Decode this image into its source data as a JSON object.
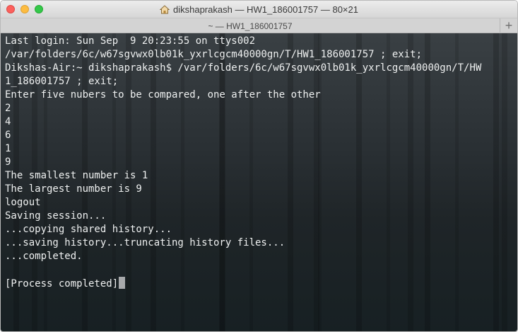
{
  "window": {
    "title": "dikshaprakash — HW1_186001757 — 80×21",
    "title_icon": "home-icon"
  },
  "tabbar": {
    "tab_label": "~ — HW1_186001757",
    "add_label": "+"
  },
  "terminal": {
    "lines": [
      "Last login: Sun Sep  9 20:23:55 on ttys002",
      "/var/folders/6c/w67sgvwx0lb01k_yxrlcgcm40000gn/T/HW1_186001757 ; exit;",
      "Dikshas-Air:~ dikshaprakash$ /var/folders/6c/w67sgvwx0lb01k_yxrlcgcm40000gn/T/HW",
      "1_186001757 ; exit;",
      "Enter five nubers to be compared, one after the other",
      "2",
      "4",
      "6",
      "1",
      "9",
      "The smallest number is 1",
      "The largest number is 9",
      "logout",
      "Saving session...",
      "...copying shared history...",
      "...saving history...truncating history files...",
      "...completed.",
      "",
      "[Process completed]"
    ]
  },
  "colors": {
    "close": "#fc605c",
    "minimize": "#fdbc40",
    "maximize": "#34c84a",
    "terminal_text": "#eef0f0"
  }
}
